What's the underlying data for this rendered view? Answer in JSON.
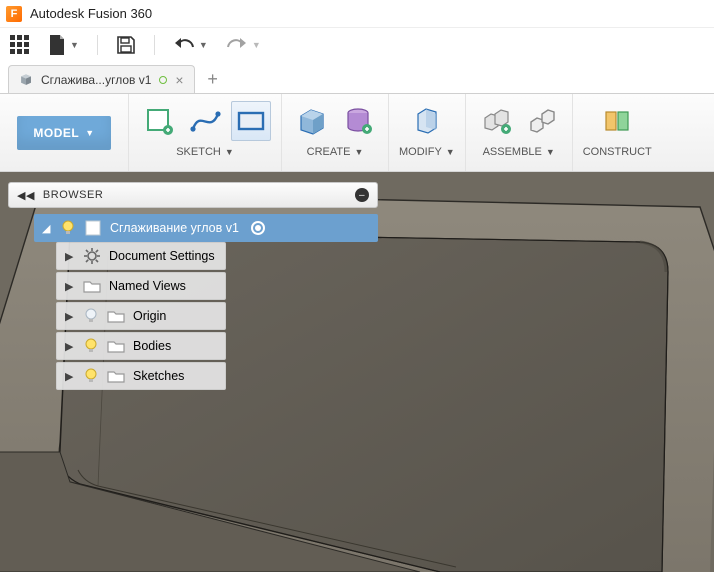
{
  "app": {
    "title": "Autodesk Fusion 360"
  },
  "document": {
    "tab_label": "Сглажива...углов v1"
  },
  "workspace": {
    "label": "MODEL"
  },
  "ribbon": {
    "sketch": "SKETCH",
    "create": "CREATE",
    "modify": "MODIFY",
    "assemble": "ASSEMBLE",
    "construct": "CONSTRUCT"
  },
  "browser": {
    "title": "BROWSER",
    "root": "Сглаживание углов v1",
    "items": [
      {
        "label": "Document Settings"
      },
      {
        "label": "Named Views"
      },
      {
        "label": "Origin"
      },
      {
        "label": "Bodies"
      },
      {
        "label": "Sketches"
      }
    ]
  }
}
